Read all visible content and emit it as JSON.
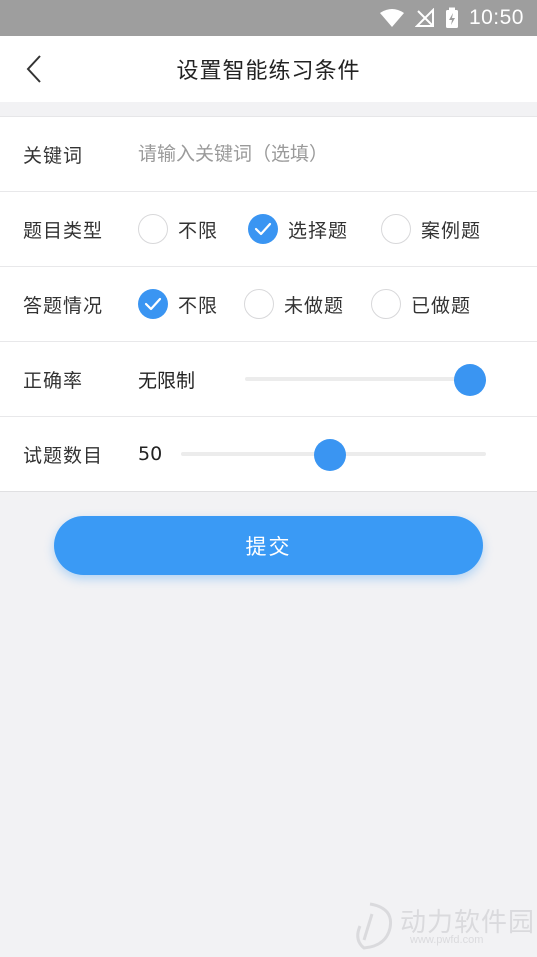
{
  "status_bar": {
    "time": "10:50"
  },
  "nav": {
    "title": "设置智能练习条件"
  },
  "keyword": {
    "label": "关键词",
    "value": "",
    "placeholder": "请输入关键词（选填）"
  },
  "question_type": {
    "label": "题目类型",
    "options": [
      {
        "label": "不限",
        "checked": false
      },
      {
        "label": "选择题",
        "checked": true
      },
      {
        "label": "案例题",
        "checked": false
      }
    ]
  },
  "answer_status": {
    "label": "答题情况",
    "options": [
      {
        "label": "不限",
        "checked": true
      },
      {
        "label": "未做题",
        "checked": false
      },
      {
        "label": "已做题",
        "checked": false
      }
    ]
  },
  "accuracy": {
    "label": "正确率",
    "value_text": "无限制",
    "slider_fraction": 1.0
  },
  "question_count": {
    "label": "试题数目",
    "value_text": "50",
    "slider_fraction": 0.49
  },
  "submit": {
    "label": "提交"
  },
  "watermark": {
    "text": "动力软件园",
    "sub": "www.pwfd.com"
  },
  "colors": {
    "accent": "#3a95f2",
    "status_bar": "#9e9e9e"
  }
}
